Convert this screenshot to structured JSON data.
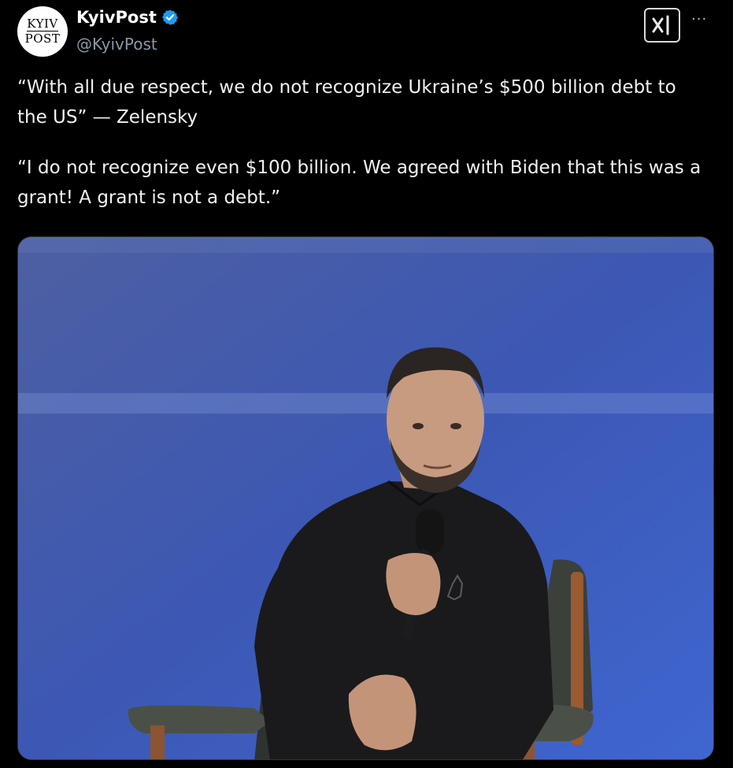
{
  "post": {
    "avatar": {
      "line1": "KYIV",
      "line2": "POST"
    },
    "display_name": "KyivPost",
    "verified_icon": "verified-badge-icon",
    "handle": "@KyivPost",
    "actions": {
      "grok_icon": "xai-grok-icon",
      "more_label": "···"
    },
    "text": {
      "paragraph1": "“With all due respect, we do not recognize Ukraine’s $500 billion debt to the US” — Zelensky",
      "paragraph2": "“I do not recognize even $100 billion. We agreed with Biden that this was a grant! A grant is not a debt.”"
    }
  },
  "colors": {
    "background": "#000000",
    "text": "#f0f2f3",
    "secondary_text": "#8b98a5",
    "verified": "#1d9bf0",
    "media_backdrop": "#3b5bc0"
  }
}
